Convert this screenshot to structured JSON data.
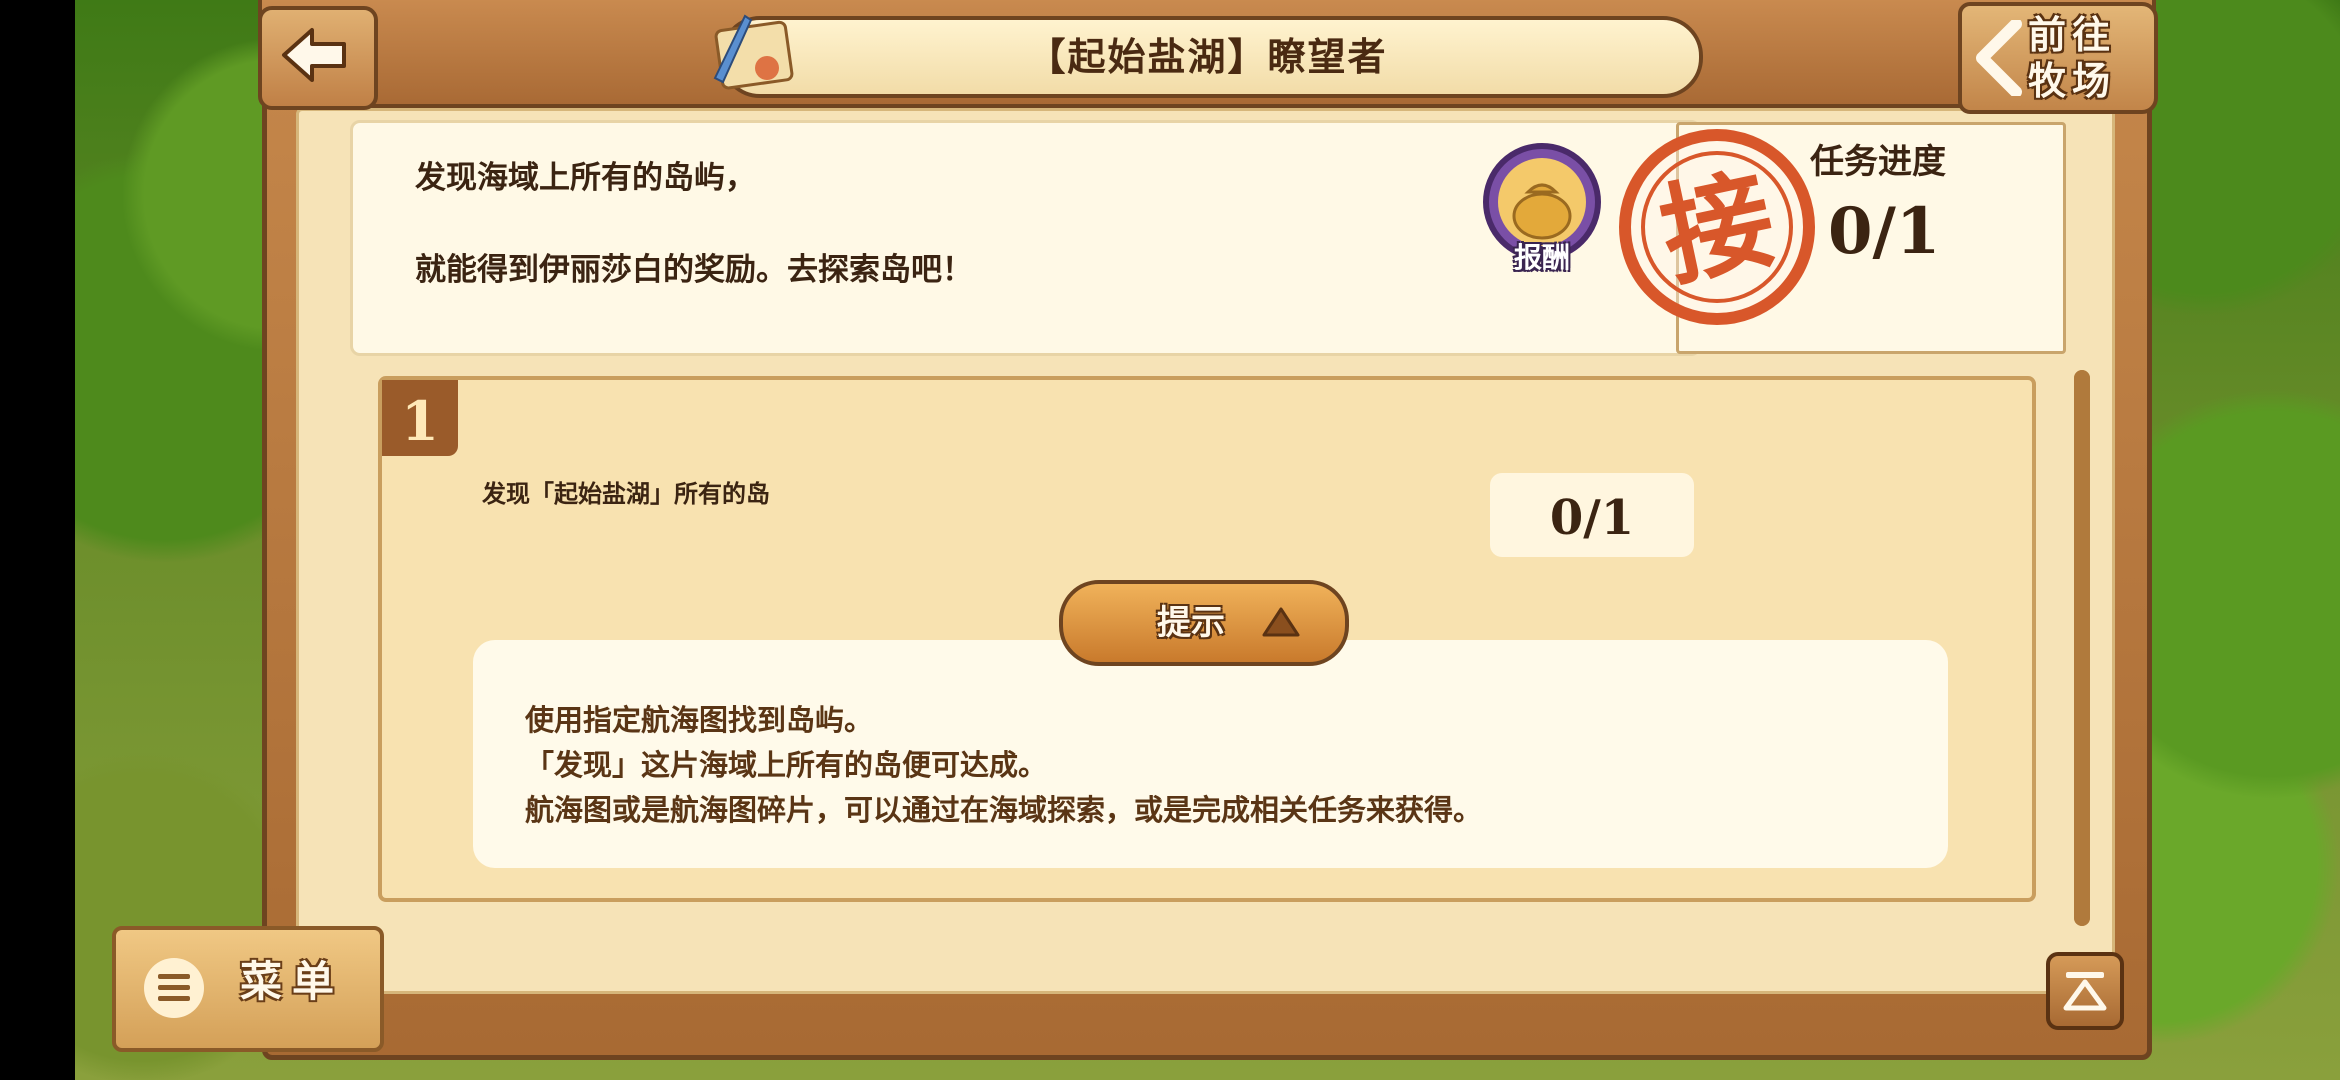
{
  "header": {
    "title": "【起始盐湖】瞭望者",
    "back_icon": "back-arrow-icon",
    "goto_ranch_label_line1": "前往",
    "goto_ranch_label_line2": "牧场"
  },
  "description": {
    "line1": "发现海域上所有的岛屿，",
    "line2": "就能得到伊丽莎白的奖励。去探索岛吧！",
    "reward_label": "报酬",
    "stamp_char": "接"
  },
  "progress": {
    "label": "任务进度",
    "value": "0/1"
  },
  "tasks": [
    {
      "number": "1",
      "text": "发现「起始盐湖」所有的岛",
      "count": "0/1"
    }
  ],
  "hint": {
    "button_label": "提示",
    "lines": [
      "使用指定航海图找到岛屿。",
      "「发现」这片海域上所有的岛便可达成。",
      "航海图或是航海图碎片，可以通过在海域探索，或是完成相关任务来获得。"
    ]
  },
  "menu": {
    "label": "菜单"
  },
  "colors": {
    "wood": "#a86a33",
    "paper": "#fff9e6",
    "text": "#3b2412",
    "stamp": "#d8572a"
  }
}
